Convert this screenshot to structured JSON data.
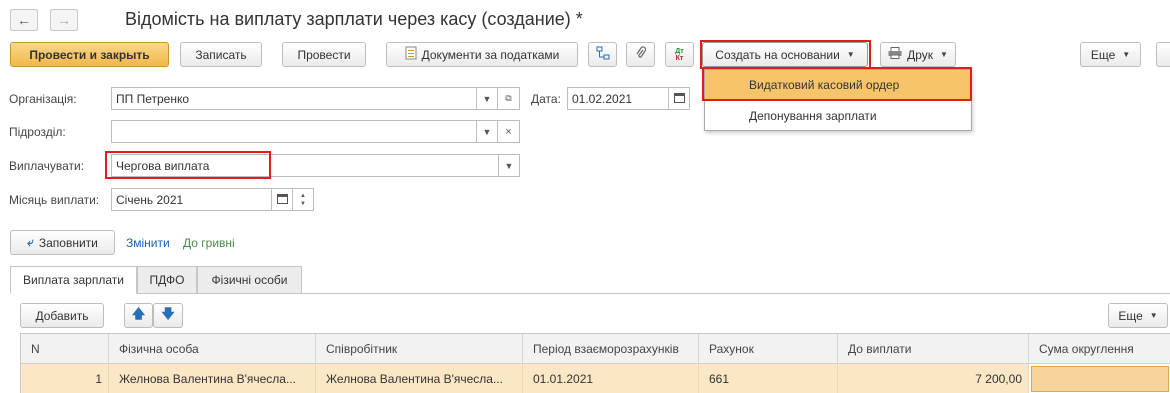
{
  "window": {
    "title": "Відомість на виплату зарплати через касу (создание) *"
  },
  "toolbar": {
    "post_and_close": "Провести и закрыть",
    "save": "Записать",
    "post": "Провести",
    "tax_documents": "Документи за податками",
    "create_based_on": "Создать на основании",
    "print": "Друк",
    "more": "Еще"
  },
  "dropdown": {
    "items": [
      "Видатковий касовий ордер",
      "Депонування зарплати"
    ]
  },
  "form": {
    "organization_label": "Організація:",
    "organization_value": "ПП Петренко",
    "date_label": "Дата:",
    "date_value": "01.02.2021",
    "department_label": "Підрозділ:",
    "department_value": "",
    "pay_label": "Виплачувати:",
    "pay_value": "Чергова виплата",
    "month_label": "Місяць виплати:",
    "month_value": "Січень 2021"
  },
  "actions": {
    "fill": "Заповнити",
    "change": "Змінити",
    "to_hryvnia": "До гривні"
  },
  "tabs": [
    "Виплата зарплати",
    "ПДФО",
    "Фізичні особи"
  ],
  "table_toolbar": {
    "add": "Добавить",
    "more": "Еще"
  },
  "table": {
    "columns": [
      "N",
      "Фізична особа",
      "Співробітник",
      "Період взаєморозрахунків",
      "Рахунок",
      "До виплати",
      "Сума округлення"
    ],
    "rows": [
      [
        "1",
        "Желнова Валентина В'ячесла...",
        "Желнова Валентина В'ячесла...",
        "01.01.2021",
        "661",
        "7 200,00",
        ""
      ]
    ]
  },
  "colors": {
    "accent": "#f1b84a",
    "highlight_border": "#e21b1b",
    "selected_row": "#fbe7c6",
    "link": "#1a5fb4"
  }
}
